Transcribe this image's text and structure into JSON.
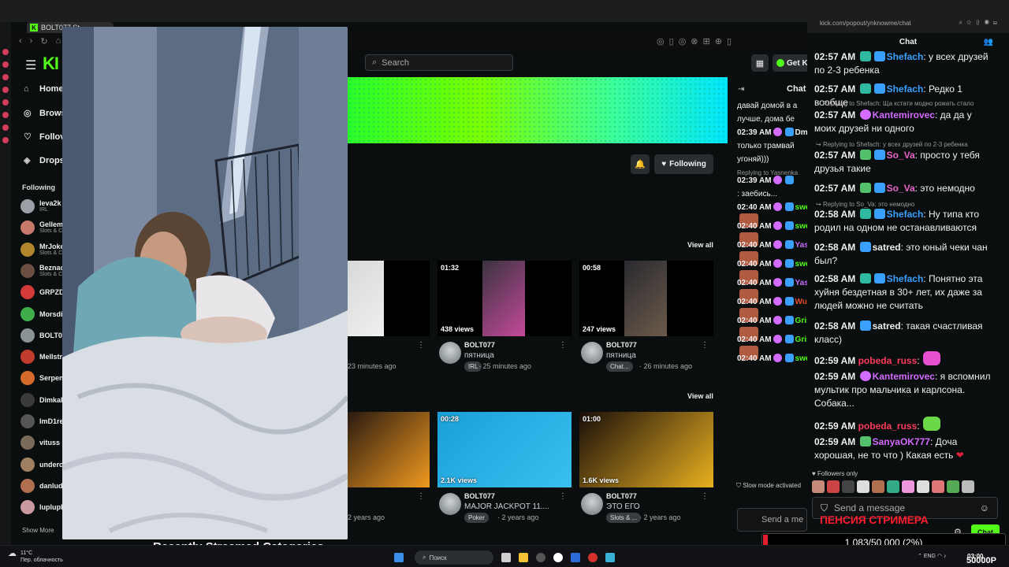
{
  "browser": {
    "tab_title": "BOLT077 St",
    "popout_url": "kick.com/popout/ynknowme/chat"
  },
  "header": {
    "logo": "KI",
    "search_placeholder": "Search",
    "get_kick": "Get K"
  },
  "sidebar": {
    "nav": [
      "Home",
      "Brows",
      "Follov",
      "Drops"
    ],
    "following_title": "Following",
    "following": [
      {
        "name": "leva2k",
        "sub": "IRL",
        "color": "#9aa0a6"
      },
      {
        "name": "Gellem",
        "sub": "Slots & C",
        "color": "#c77a6b"
      },
      {
        "name": "MrJoke",
        "sub": "Slots & C",
        "color": "#b0852e"
      },
      {
        "name": "Beznac",
        "sub": "Slots & C",
        "color": "#6a4e3f"
      },
      {
        "name": "GRPZD",
        "sub": "",
        "color": "#d33b3b"
      },
      {
        "name": "Morsdi",
        "sub": "",
        "color": "#3fae4a"
      },
      {
        "name": "BOLT0",
        "sub": "",
        "color": "#8a9396"
      },
      {
        "name": "Mellstr",
        "sub": "",
        "color": "#c23b2f"
      },
      {
        "name": "Serpen",
        "sub": "",
        "color": "#d46b2a"
      },
      {
        "name": "Dimkal",
        "sub": "",
        "color": "#3a3a3a"
      },
      {
        "name": "ImD1re",
        "sub": "",
        "color": "#555"
      },
      {
        "name": "vituss",
        "sub": "",
        "color": "#7a6a5a"
      },
      {
        "name": "underc",
        "sub": "",
        "color": "#a08060"
      },
      {
        "name": "danlud",
        "sub": "",
        "color": "#b07050"
      },
      {
        "name": "luplupl",
        "sub": "",
        "color": "#c99aa0"
      }
    ],
    "show_more": "Show More"
  },
  "channel": {
    "follow_label": "Following",
    "view_all_1": "View all",
    "view_all_2": "View all",
    "recent_categories": "Recently Streamed Categories"
  },
  "clips_row1": [
    {
      "duration": "",
      "views": "",
      "channel": "",
      "title": "",
      "tag": "",
      "ago": "23 minutes ago"
    },
    {
      "duration": "01:32",
      "views": "438 views",
      "channel": "BOLT077",
      "title": "пятница",
      "tag": "IRL",
      "ago": "· 25 minutes ago"
    },
    {
      "duration": "00:58",
      "views": "247 views",
      "channel": "BOLT077",
      "title": "пятница",
      "tag": "Chat...",
      "ago": "· 26 minutes ago"
    }
  ],
  "clips_row2": [
    {
      "duration": "",
      "views": "",
      "channel": "",
      "title": "",
      "tag": "",
      "ago": "2 years ago"
    },
    {
      "duration": "00:28",
      "views": "2.1K views",
      "channel": "BOLT077",
      "title": "MAJOR JACKPOT 11....",
      "tag": "Poker",
      "ago": "· 2 years ago"
    },
    {
      "duration": "01:00",
      "views": "1.6K views",
      "channel": "BOLT077",
      "title": "ЭТО ЕГО",
      "tag": "Slots & ...",
      "ago": "· 2 years ago"
    }
  ],
  "inner_chat": {
    "title": "Chat",
    "lines": [
      {
        "t": "давай домой в а"
      },
      {
        "t": "лучше, дома бе"
      },
      {
        "t": "02:39 AM",
        "u": "Dm",
        "c": "#efeff1"
      },
      {
        "t": "только трамвай"
      },
      {
        "t": "угоняй)))"
      },
      {
        "t": "Replying to Yasnenka",
        "reply": true
      },
      {
        "t": "02:39 AM",
        "u": "",
        "c": "#efeff1"
      },
      {
        "t": ": заебись..."
      },
      {
        "t": "02:40 AM",
        "u": "swe",
        "c": "#53fc18"
      },
      {
        "t": "02:40 AM",
        "u": "swe",
        "c": "#53fc18"
      },
      {
        "t": "02:40 AM",
        "u": "Yas",
        "c": "#c86bff"
      },
      {
        "t": "02:40 AM",
        "u": "swe",
        "c": "#53fc18"
      },
      {
        "t": "02:40 AM",
        "u": "Yas",
        "c": "#c86bff"
      },
      {
        "t": "02:40 AM",
        "u": "Wussy",
        "c": "#e24a2c"
      },
      {
        "t": "02:40 AM",
        "u": "Gris",
        "c": "#53fc18"
      },
      {
        "t": "02:40 AM",
        "u": "Gris",
        "c": "#53fc18"
      },
      {
        "t": "02:40 AM",
        "u": "swe",
        "c": "#53fc18"
      }
    ],
    "slow_mode": "Slow mode activated",
    "input_placeholder": "Send a me"
  },
  "popout_chat": {
    "title": "Chat",
    "messages": [
      {
        "time": "02:57 AM",
        "user": "Shefach",
        "color": "#3aa0ff",
        "text": ": у всех друзей по 2-3 ребенка"
      },
      {
        "time": "02:57 AM",
        "user": "Shefach",
        "color": "#3aa0ff",
        "text": ": Редко 1 вообще"
      },
      {
        "reply": "Replying to Shefach: Ща кстати модно рожать стало"
      },
      {
        "time": "02:57 AM",
        "user": "Kantemirovec",
        "color": "#d36bff",
        "text": ": да да у моих друзей ни одного"
      },
      {
        "reply": "Replying to Shefach: у всех друзей по 2-3 ребенка"
      },
      {
        "time": "02:57 AM",
        "user": "So_Va",
        "color": "#e865c8",
        "text": ": просто у тебя друзья такие"
      },
      {
        "time": "02:57 AM",
        "user": "So_Va",
        "color": "#e865c8",
        "text": ": это немодно"
      },
      {
        "reply": "Replying to So_Va: это немодно"
      },
      {
        "time": "02:58 AM",
        "user": "Shefach",
        "color": "#3aa0ff",
        "text": ": Ну типа кто родил на одном не останавливаются"
      },
      {
        "time": "02:58 AM",
        "user": "satred",
        "color": "#efeff1",
        "text": ": это юный чеки чан был?"
      },
      {
        "time": "02:58 AM",
        "user": "Shefach",
        "color": "#3aa0ff",
        "text": ": Понятно эта хуйня бездетная в 30+ лет, их даже за людей можно не считать"
      },
      {
        "time": "02:58 AM",
        "user": "satred",
        "color": "#efeff1",
        "text": ": такая счастливая класс)"
      },
      {
        "time": "02:59 AM",
        "user": "pobeda_russ",
        "color": "#ff3b5c",
        "text": ":"
      },
      {
        "time": "02:59 AM",
        "user": "Kantemirovec",
        "color": "#d36bff",
        "text": ": я вспомнил мультик про мальчика и карлсона. Собака..."
      },
      {
        "time": "02:59 AM",
        "user": "pobeda_russ",
        "color": "#ff3b5c",
        "text": ":"
      },
      {
        "time": "02:59 AM",
        "user": "SanyaOK777",
        "color": "#d36bff",
        "text": ": Доча хорошая, не то что ) Какая есть"
      }
    ],
    "followers_only": "Followers only",
    "input_placeholder": "Send a message",
    "chat_button": "Chat",
    "overlay_text": "ПЕНСИЯ СТРИМЕРА"
  },
  "goal": {
    "label": "1 083/50 000 (2%)",
    "progress": 0.02,
    "corner_left": "OP",
    "corner_right": "50000P"
  },
  "taskbar": {
    "weather_temp": "11°C",
    "weather_desc": "Пер. облачность",
    "search": "Поиск",
    "lang": "ENG",
    "clock_time": "03:00",
    "clock_date": "26"
  }
}
